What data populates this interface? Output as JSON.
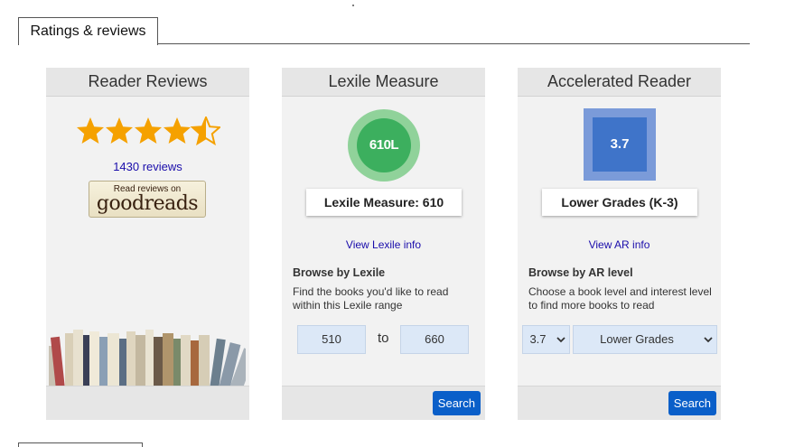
{
  "tabs": {
    "active_label": "Ratings & reviews"
  },
  "reader_reviews": {
    "heading": "Reader Reviews",
    "rating": 4.5,
    "rating_max": 5,
    "star_color": "#f5a100",
    "reviews_link": "1430 reviews",
    "goodreads_small": "Read reviews on",
    "goodreads_brand": "goodreads"
  },
  "lexile": {
    "heading": "Lexile Measure",
    "badge": "610L",
    "measure_label": "Lexile Measure: 610",
    "info_link": "View Lexile info",
    "browse_title": "Browse by Lexile",
    "browse_desc": "Find the books you'd like to read within this Lexile range",
    "range_from": "510",
    "range_to_label": "to",
    "range_to": "660",
    "search_label": "Search"
  },
  "accelerated_reader": {
    "heading": "Accelerated Reader",
    "badge": "3.7",
    "grade_label": "Lower Grades (K-3)",
    "info_link": "View AR info",
    "browse_title": "Browse by AR level",
    "browse_desc": "Choose a book level and interest level to find more books to read",
    "level_select": "3.7",
    "interest_select": "Lower Grades",
    "search_label": "Search"
  },
  "colors": {
    "link": "#1a0dab",
    "button": "#0a5fc9",
    "lexile_ring": "#90d29a",
    "lexile_core": "#3caf5e",
    "ar_outer": "#7b9bd9",
    "ar_inner": "#3f74c9"
  }
}
